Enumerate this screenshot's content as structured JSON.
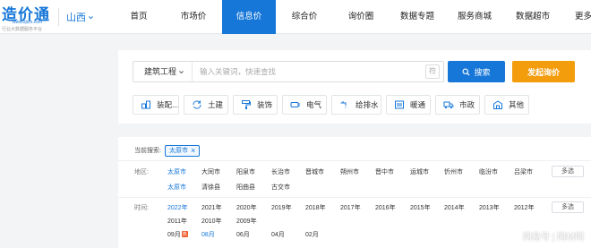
{
  "logo": {
    "main": "造价通",
    "url": "www.zjtcn.com",
    "slogan": "行业大数据服务平台"
  },
  "city": {
    "label": "山西"
  },
  "nav": [
    {
      "label": "首页",
      "active": false
    },
    {
      "label": "市场价",
      "active": false
    },
    {
      "label": "信息价",
      "active": true
    },
    {
      "label": "综合价",
      "active": false
    },
    {
      "label": "询价圈",
      "active": false
    },
    {
      "label": "数据专题",
      "active": false
    },
    {
      "label": "服务商城",
      "active": false
    },
    {
      "label": "数据超市",
      "active": false
    },
    {
      "label": "更多",
      "active": false
    }
  ],
  "search": {
    "category": "建筑工程",
    "placeholder": "输入关键词，快速查找",
    "char_key": "符",
    "button_label": "搜索",
    "inquiry_label": "发起询价"
  },
  "categories": [
    {
      "label": "装配...",
      "icon": "building-blocks-icon"
    },
    {
      "label": "土建",
      "icon": "refresh-tools-icon"
    },
    {
      "label": "装饰",
      "icon": "paint-roller-icon"
    },
    {
      "label": "电气",
      "icon": "cable-icon"
    },
    {
      "label": "给排水",
      "icon": "faucet-icon"
    },
    {
      "label": "暖通",
      "icon": "hvac-icon"
    },
    {
      "label": "市政",
      "icon": "truck-icon"
    },
    {
      "label": "其他",
      "icon": "warehouse-icon"
    }
  ],
  "filters": {
    "current_label": "当前搜索:",
    "current_tag": "太原市",
    "region_label": "地区:",
    "region_row1": [
      "太原市",
      "大同市",
      "阳泉市",
      "长治市",
      "晋城市",
      "朔州市",
      "晋中市",
      "运城市",
      "忻州市",
      "临汾市",
      "吕梁市"
    ],
    "region_row2": [
      "太原市",
      "清徐县",
      "阳曲县",
      "古交市"
    ],
    "time_label": "时间:",
    "time_row1": [
      "2022年",
      "2021年",
      "2020年",
      "2019年",
      "2018年",
      "2017年",
      "2016年",
      "2015年",
      "2014年",
      "2013年",
      "2012年"
    ],
    "time_row2": [
      "2011年",
      "2010年",
      "2009年"
    ],
    "month_row": [
      "09月",
      "08月",
      "06月",
      "04月",
      "02月"
    ],
    "hot_badge": "热",
    "multi_label": "多选"
  },
  "watermark": "网易号 | 网材网",
  "colors": {
    "primary": "#1677d9",
    "accent": "#f39c0c",
    "hot": "#f25b2a"
  }
}
